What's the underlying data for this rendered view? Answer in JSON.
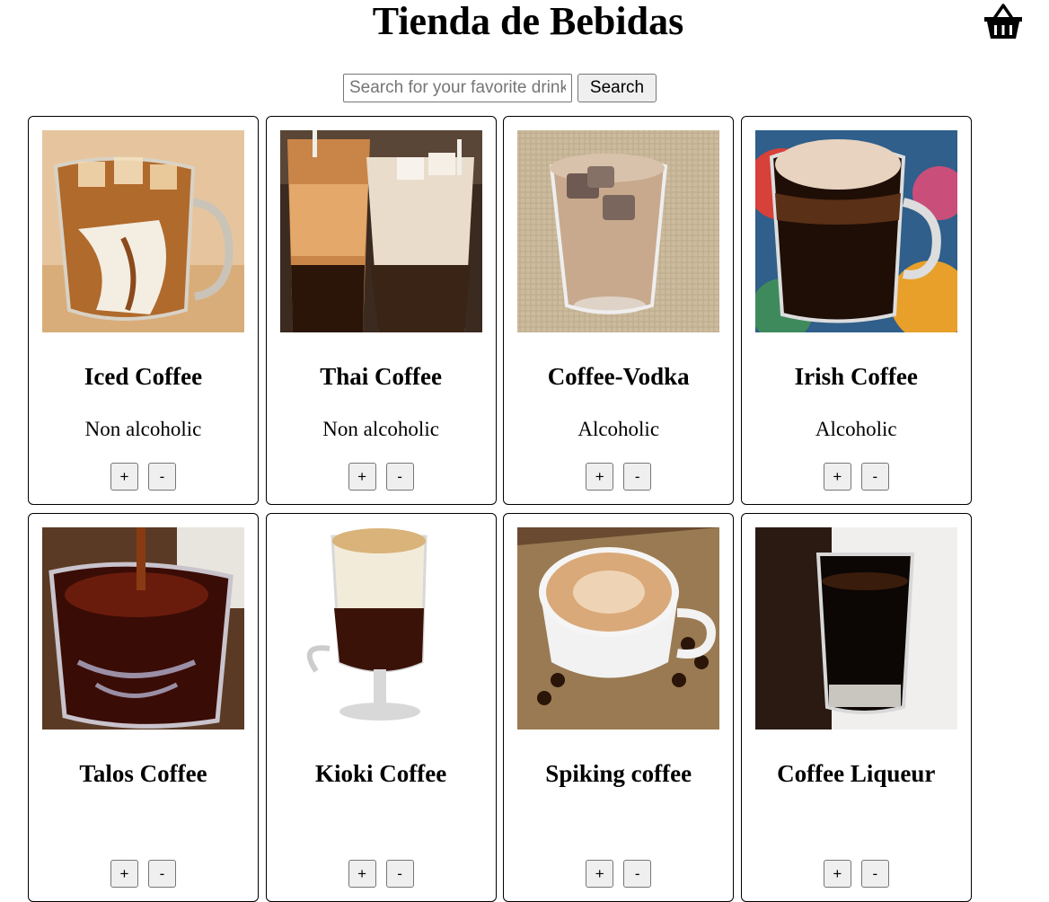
{
  "header": {
    "title": "Tienda de Bebidas",
    "cart_icon": "basket-icon"
  },
  "search": {
    "placeholder": "Search for your favorite drink",
    "value": "",
    "button_label": "Search"
  },
  "drinks": [
    {
      "name": "Iced Coffee",
      "type": "Non alcoholic",
      "plus_label": "+",
      "minus_label": "-"
    },
    {
      "name": "Thai Coffee",
      "type": "Non alcoholic",
      "plus_label": "+",
      "minus_label": "-"
    },
    {
      "name": "Coffee-Vodka",
      "type": "Alcoholic",
      "plus_label": "+",
      "minus_label": "-"
    },
    {
      "name": "Irish Coffee",
      "type": "Alcoholic",
      "plus_label": "+",
      "minus_label": "-"
    },
    {
      "name": "Talos Coffee",
      "type": "",
      "plus_label": "+",
      "minus_label": "-"
    },
    {
      "name": "Kioki Coffee",
      "type": "",
      "plus_label": "+",
      "minus_label": "-"
    },
    {
      "name": "Spiking coffee",
      "type": "",
      "plus_label": "+",
      "minus_label": "-"
    },
    {
      "name": "Coffee Liqueur",
      "type": "",
      "plus_label": "+",
      "minus_label": "-"
    }
  ]
}
